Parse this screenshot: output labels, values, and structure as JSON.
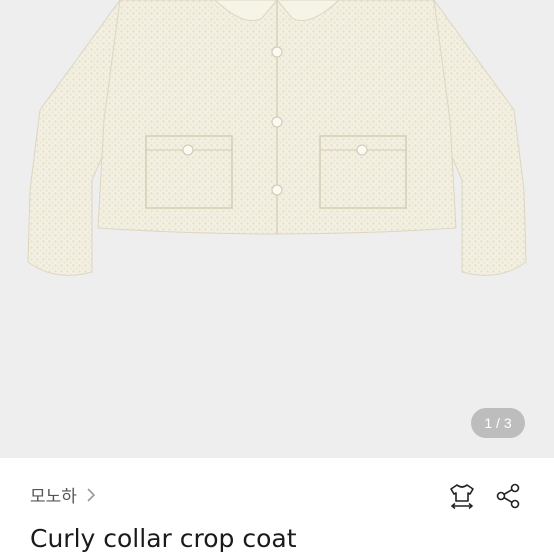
{
  "gallery": {
    "image": "product-photo-cream-boucle-cropped-jacket",
    "counter": "1 / 3",
    "background": "#eeeeee"
  },
  "shop": {
    "name": "모노하",
    "chevron_icon": "chevron-right-icon"
  },
  "actions": {
    "size_guide_icon": "tshirt-size-icon",
    "share_icon": "share-icon"
  },
  "product": {
    "title": "Curly collar crop coat"
  }
}
